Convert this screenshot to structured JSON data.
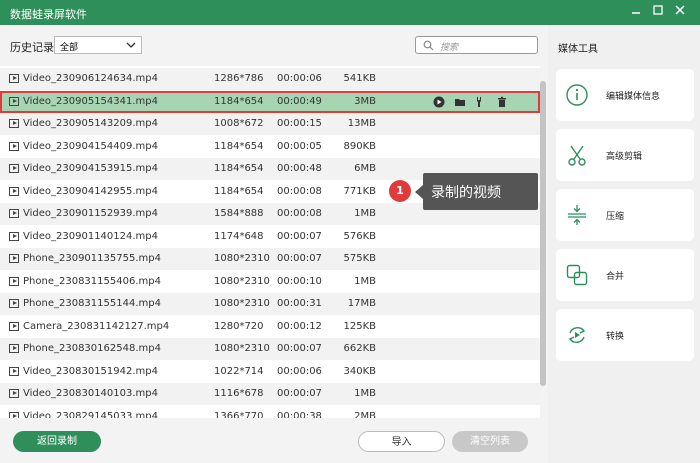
{
  "window": {
    "title": "数据蛙录屏软件"
  },
  "toolbar": {
    "history_label": "历史记录",
    "filter_value": "全部",
    "search_placeholder": "搜索"
  },
  "files": [
    {
      "name": "Video_230906124634.mp4",
      "resolution": "1286*786",
      "duration": "00:00:06",
      "size": "541KB"
    },
    {
      "name": "Video_230905154341.mp4",
      "resolution": "1184*654",
      "duration": "00:00:49",
      "size": "3MB",
      "selected": true
    },
    {
      "name": "Video_230905143209.mp4",
      "resolution": "1008*672",
      "duration": "00:00:15",
      "size": "13MB"
    },
    {
      "name": "Video_230904154409.mp4",
      "resolution": "1184*654",
      "duration": "00:00:05",
      "size": "890KB"
    },
    {
      "name": "Video_230904153915.mp4",
      "resolution": "1184*654",
      "duration": "00:00:48",
      "size": "6MB"
    },
    {
      "name": "Video_230904142955.mp4",
      "resolution": "1184*654",
      "duration": "00:00:08",
      "size": "771KB"
    },
    {
      "name": "Video_230901152939.mp4",
      "resolution": "1584*888",
      "duration": "00:00:08",
      "size": "1MB"
    },
    {
      "name": "Video_230901140124.mp4",
      "resolution": "1174*648",
      "duration": "00:00:07",
      "size": "576KB"
    },
    {
      "name": "Phone_230901135755.mp4",
      "resolution": "1080*2310",
      "duration": "00:00:07",
      "size": "575KB"
    },
    {
      "name": "Phone_230831155406.mp4",
      "resolution": "1080*2310",
      "duration": "00:00:10",
      "size": "1MB"
    },
    {
      "name": "Phone_230831155144.mp4",
      "resolution": "1080*2310",
      "duration": "00:00:31",
      "size": "17MB"
    },
    {
      "name": "Camera_230831142127.mp4",
      "resolution": "1280*720",
      "duration": "00:00:12",
      "size": "125KB"
    },
    {
      "name": "Phone_230830162548.mp4",
      "resolution": "1080*2310",
      "duration": "00:00:07",
      "size": "662KB"
    },
    {
      "name": "Video_230830151942.mp4",
      "resolution": "1022*714",
      "duration": "00:00:06",
      "size": "340KB"
    },
    {
      "name": "Video_230830140103.mp4",
      "resolution": "1116*678",
      "duration": "00:00:07",
      "size": "1MB"
    },
    {
      "name": "Video_230829145033.mp4",
      "resolution": "1366*770",
      "duration": "00:00:38",
      "size": "2MB"
    }
  ],
  "row_actions": [
    "play-icon",
    "folder-icon",
    "wrench-icon",
    "trash-icon"
  ],
  "annotation": {
    "badge": "1",
    "text": "录制的视频"
  },
  "footer": {
    "back_label": "返回录制",
    "import_label": "导入",
    "clear_label": "清空列表"
  },
  "sidebar": {
    "title": "媒体工具",
    "tools": [
      {
        "label": "编辑媒体信息",
        "icon": "info-icon"
      },
      {
        "label": "高级剪辑",
        "icon": "scissors-icon"
      },
      {
        "label": "压缩",
        "icon": "compress-icon"
      },
      {
        "label": "合并",
        "icon": "merge-icon"
      },
      {
        "label": "转换",
        "icon": "convert-icon"
      }
    ]
  },
  "colors": {
    "brand": "#2f8f5b",
    "selected_row": "#a7d4b3",
    "highlight": "#e03a3a"
  }
}
